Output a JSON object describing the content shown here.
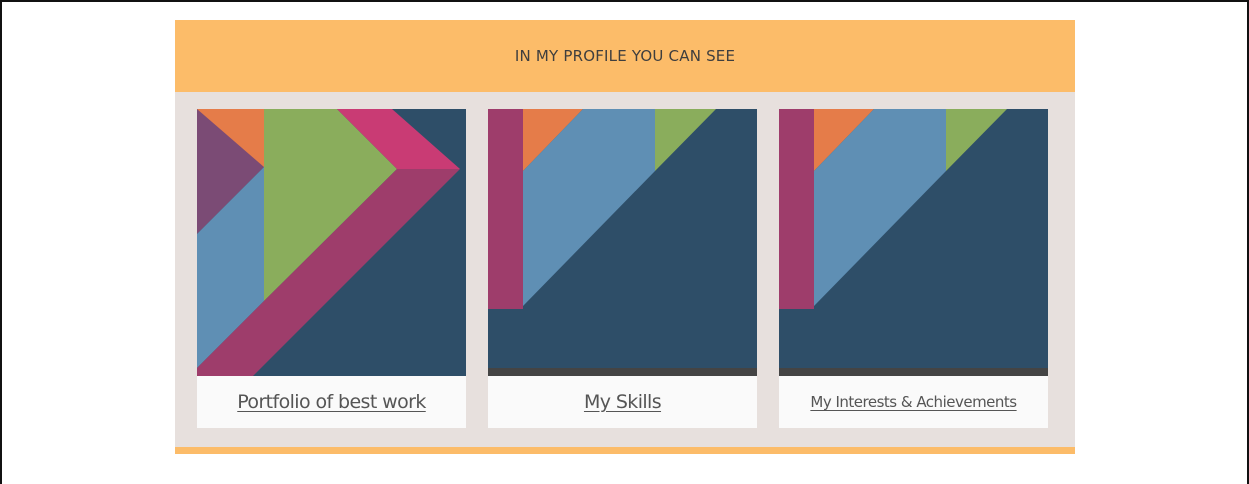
{
  "section": {
    "title": "IN MY PROFILE YOU CAN SEE"
  },
  "cards": [
    {
      "link_label": "Portfolio of best work",
      "image_icon": "geometric-tangram-art-icon"
    },
    {
      "link_label": "My Skills",
      "image_icon": "geometric-tangram-art-icon"
    },
    {
      "link_label": "My Interests & Achievements",
      "image_icon": "geometric-tangram-art-icon"
    }
  ],
  "colors": {
    "accent_orange": "#fcbc69",
    "panel_background": "#e7e0dd",
    "navy": "#2e4e68",
    "steel_blue": "#5f8fb4",
    "green": "#8aad5c",
    "orange": "#e57c49",
    "magenta": "#c93b74",
    "plum": "#9e3d6b",
    "purple": "#7b4b75",
    "dark_bar": "#444444"
  }
}
